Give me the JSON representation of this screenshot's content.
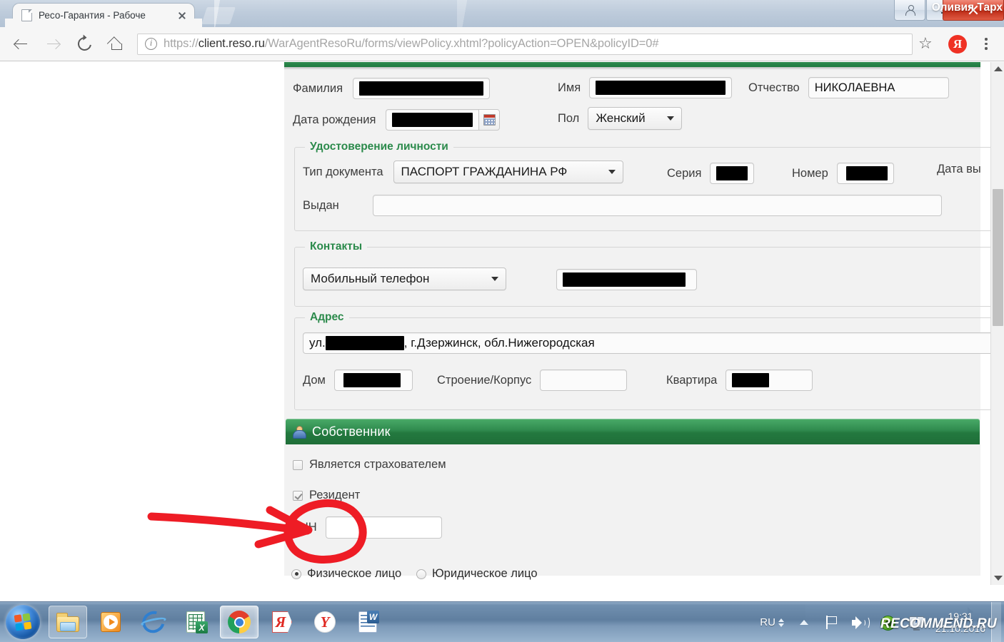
{
  "browser": {
    "tab_title": "Ресо-Гарантия - Рабоче",
    "url_protocol": "https://",
    "url_host": "client.reso.ru",
    "url_path": "/WarAgentResoRu/forms/viewPolicy.xhtml?policyAction=OPEN&policyID=0#",
    "url_full": "https://client.reso.ru/WarAgentResoRu/forms/viewPolicy.xhtml?policyAction=OPEN&policyID=0#",
    "back_icon": "back-arrow-icon",
    "forward_icon": "forward-arrow-icon",
    "reload_icon": "reload-icon",
    "home_icon": "home-icon",
    "info_icon": "info-icon",
    "bookmark_icon": "star-icon",
    "extension_icon": "yandex-extension-icon",
    "extension_letter": "Я",
    "menu_icon": "three-dot-menu-icon",
    "new_tab_icon": "new-tab-button",
    "close_tab_icon": "close-tab-icon"
  },
  "window": {
    "user_icon": "user-account-icon",
    "minimize_icon": "minimize-icon",
    "restore_icon": "restore-window-icon",
    "close_icon": "close-window-icon",
    "watermark_user": "Оливия Тарх"
  },
  "form": {
    "person": {
      "surname_label": "Фамилия",
      "surname_value": "",
      "firstname_label": "Имя",
      "firstname_value": "",
      "patronymic_label": "Отчество",
      "patronymic_value": "НИКОЛАЕВНА",
      "birthdate_label": "Дата рождения",
      "birthdate_value": "",
      "calendar_icon": "calendar-icon",
      "gender_label": "Пол",
      "gender_value": "Женский"
    },
    "identity": {
      "legend": "Удостоверение личности",
      "doctype_label": "Тип документа",
      "doctype_value": "ПАСПОРТ ГРАЖДАНИНА РФ",
      "series_label": "Серия",
      "series_value": "",
      "number_label": "Номер",
      "number_value": "",
      "issuedate_label": "Дата вы",
      "issuedby_label": "Выдан",
      "issuedby_value": ""
    },
    "contacts": {
      "legend": "Контакты",
      "type_value": "Мобильный телефон",
      "phone_value": ""
    },
    "address": {
      "legend": "Адрес",
      "street_prefix": "ул.",
      "street_rest": ", г.Дзержинск, обл.Нижегородская",
      "house_label": "Дом",
      "house_value": "",
      "building_label": "Строение/Корпус",
      "building_value": "",
      "flat_label": "Квартира",
      "flat_value": ""
    },
    "owner": {
      "section_title": "Собственник",
      "section_icon": "person-icon",
      "is_policyholder_label": "Является страхователем",
      "is_policyholder_checked": false,
      "resident_label": "Резидент",
      "resident_checked": true,
      "inn_label": "ИНН",
      "inn_value": "",
      "entity_individual_label": "Физическое лицо",
      "entity_legal_label": "Юридическое лицо",
      "entity_selected": "individual"
    }
  },
  "annotation": {
    "color": "#ee1c25",
    "shape": "red-circle-with-arrow-around-checkbox"
  },
  "scrollbars": {
    "vertical_up_icon": "scroll-up-arrow",
    "vertical_down_icon": "scroll-down-arrow",
    "horizontal_left_icon": "scroll-left-arrow",
    "horizontal_right_icon": "scroll-right-arrow"
  },
  "taskbar": {
    "start_icon": "windows-start-icon",
    "items": [
      {
        "icon": "file-explorer-icon",
        "state": "pinned-open"
      },
      {
        "icon": "windows-media-player-icon",
        "state": "pinned"
      },
      {
        "icon": "internet-explorer-icon",
        "state": "pinned"
      },
      {
        "icon": "microsoft-excel-icon",
        "state": "pinned"
      },
      {
        "icon": "google-chrome-icon",
        "state": "active"
      },
      {
        "icon": "yandex-browser-icon",
        "state": "pinned"
      },
      {
        "icon": "yandex-icon",
        "state": "pinned"
      },
      {
        "icon": "microsoft-word-icon",
        "state": "pinned"
      }
    ],
    "tray": {
      "language": "RU",
      "show_hidden_icon": "show-hidden-icons-arrow",
      "action_center_icon": "flag-icon",
      "volume_icon": "volume-icon",
      "antivirus_icon": "antivirus-icon",
      "monitor_icon": "monitor-icon",
      "time": "19:31",
      "date": "21.10.2016"
    }
  },
  "watermark": {
    "site": "RECOMMEND.RU"
  },
  "colors": {
    "brand_green": "#23793f",
    "legend_green": "#2b8a4b",
    "annotation_red": "#ee1c25",
    "chrome_red": "#ef3124"
  }
}
